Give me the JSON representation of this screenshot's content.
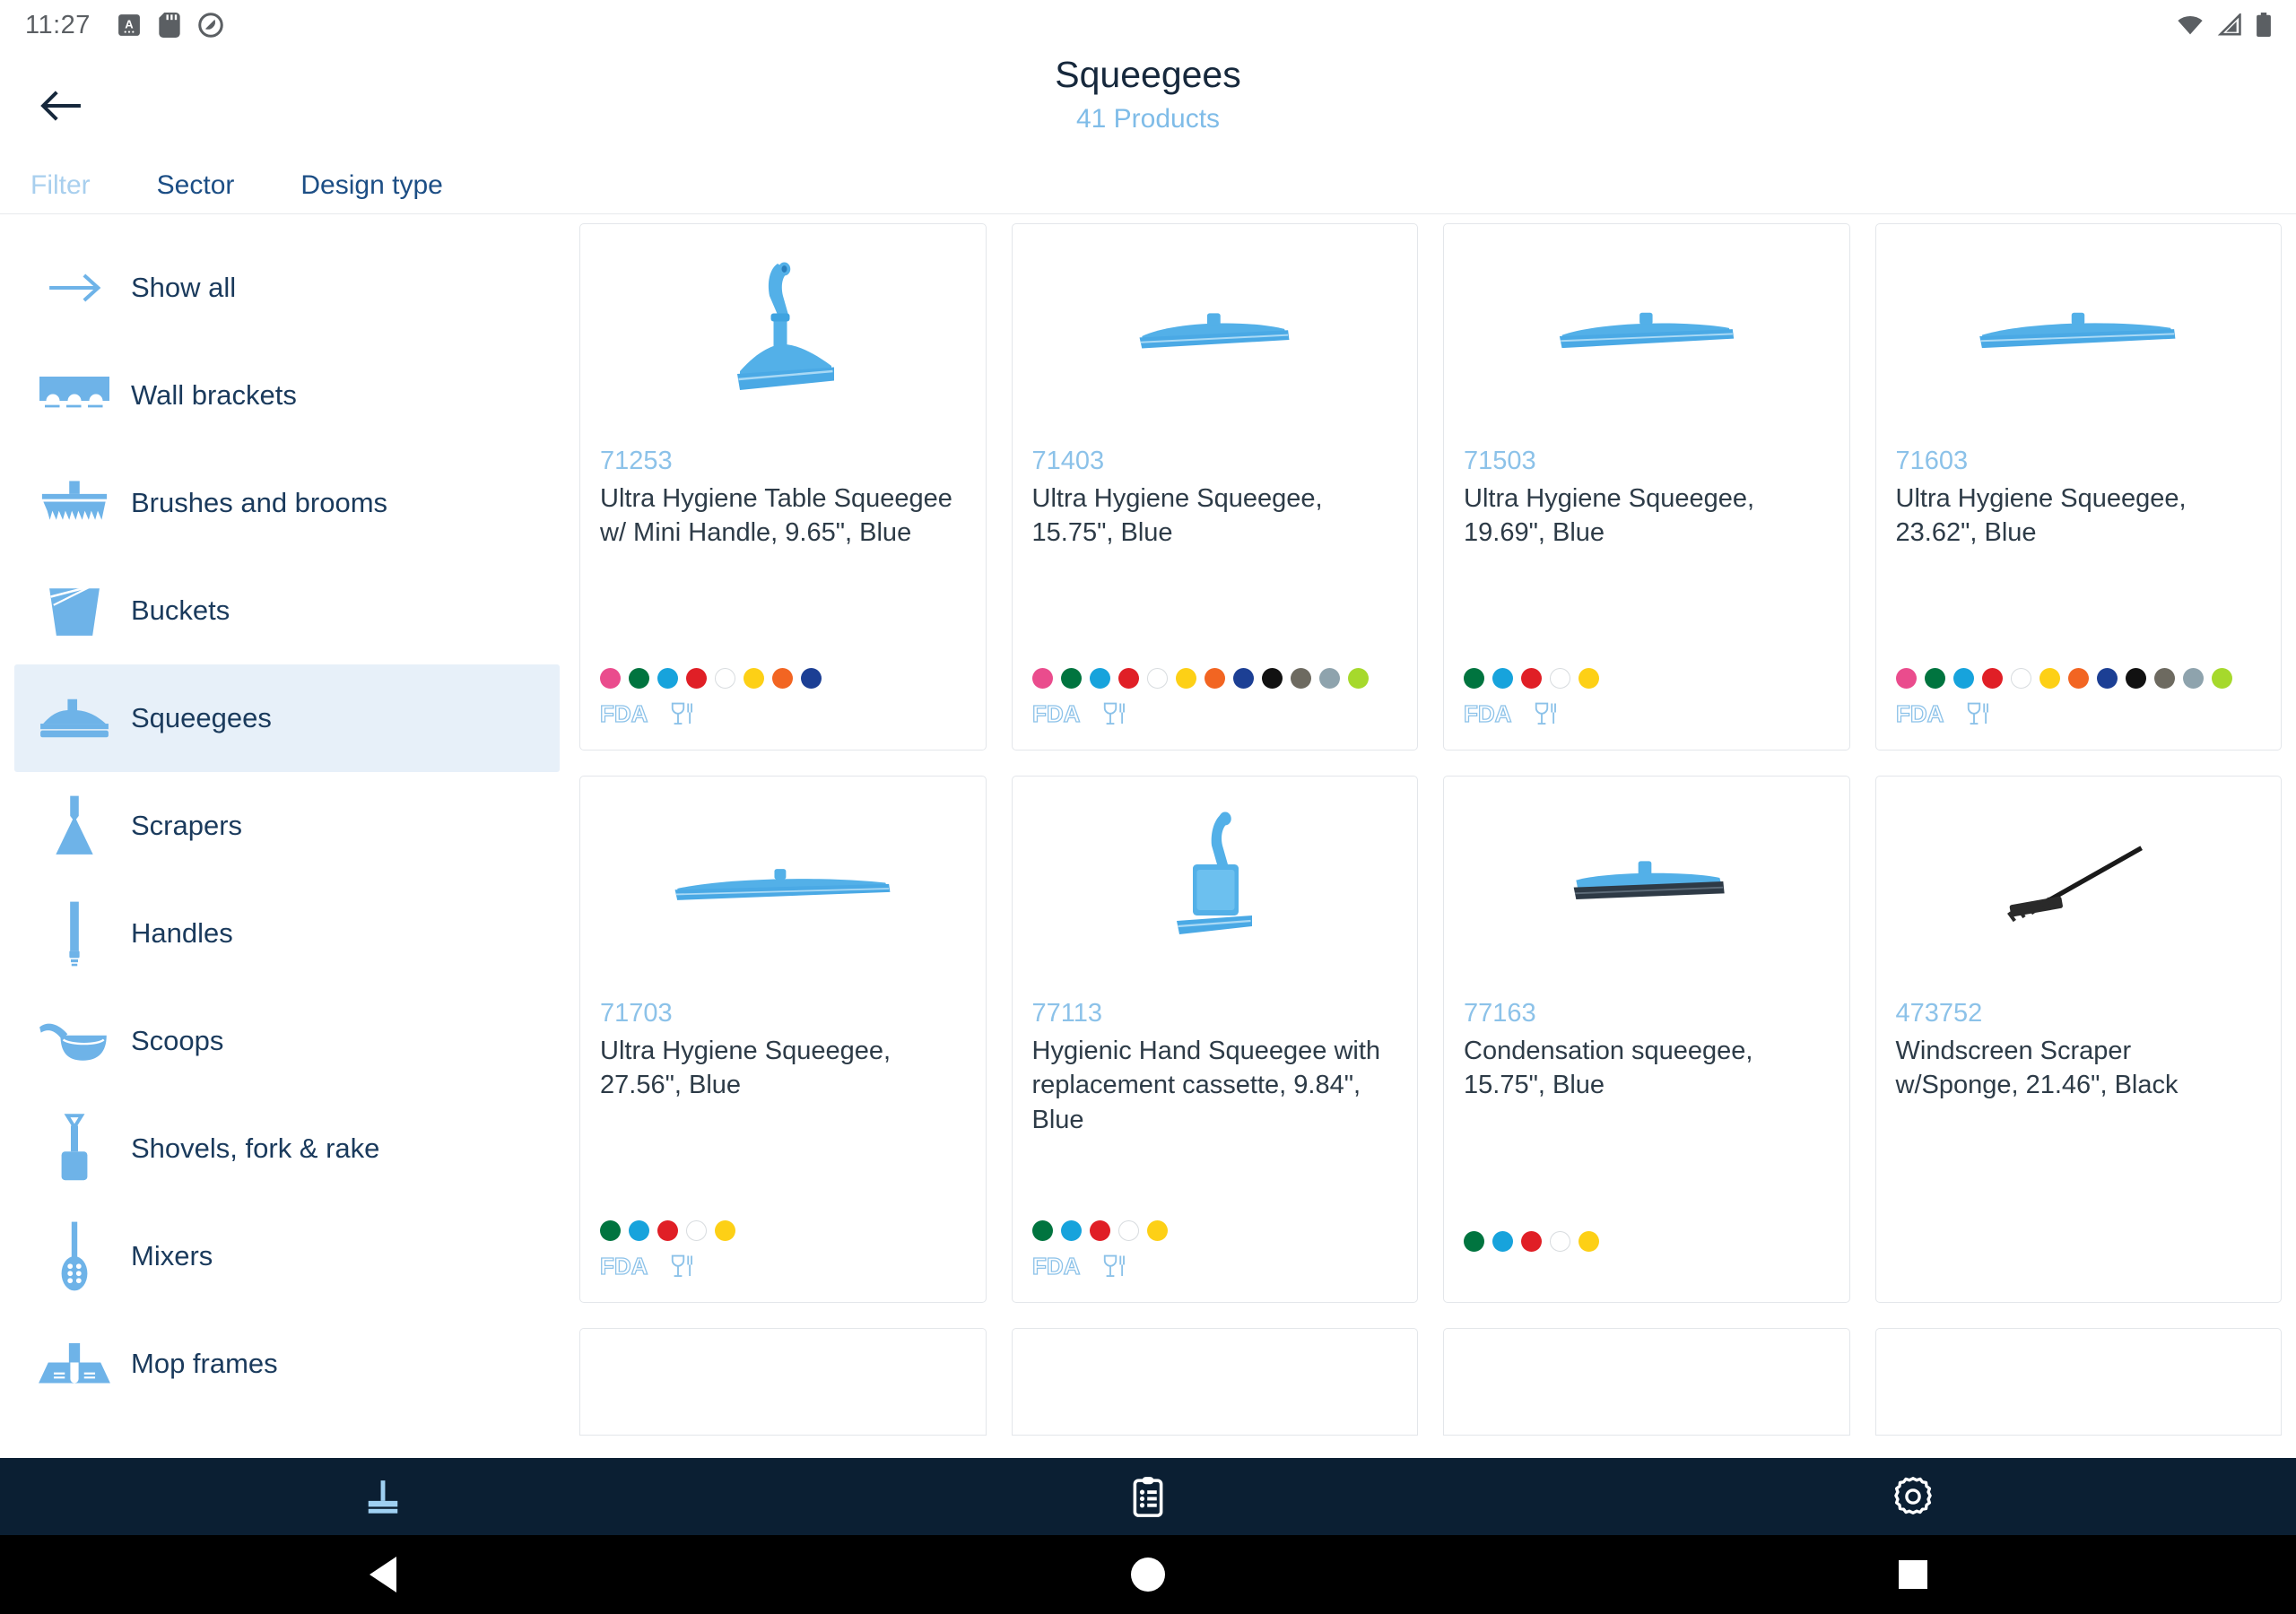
{
  "status_bar": {
    "time": "11:27",
    "left_icons": [
      "alphabet-badge-icon",
      "sd-card-icon",
      "do-not-disturb-icon"
    ],
    "right_icons": [
      "wifi-icon",
      "cellular-signal-icon",
      "battery-icon"
    ]
  },
  "app_bar": {
    "back_icon": "back-arrow-icon",
    "title": "Squeegees",
    "subtitle": "41 Products"
  },
  "filter_bar": {
    "tabs": [
      {
        "label": "Filter",
        "muted": true
      },
      {
        "label": "Sector",
        "muted": false
      },
      {
        "label": "Design type",
        "muted": false
      }
    ]
  },
  "sidebar": {
    "items": [
      {
        "label": "Show all",
        "icon": "arrow-right-icon",
        "active": false
      },
      {
        "label": "Wall brackets",
        "icon": "wall-bracket-icon",
        "active": false
      },
      {
        "label": "Brushes and brooms",
        "icon": "broom-icon",
        "active": false
      },
      {
        "label": "Buckets",
        "icon": "bucket-icon",
        "active": false
      },
      {
        "label": "Squeegees",
        "icon": "squeegee-icon",
        "active": true
      },
      {
        "label": "Scrapers",
        "icon": "scraper-icon",
        "active": false
      },
      {
        "label": "Handles",
        "icon": "handle-icon",
        "active": false
      },
      {
        "label": "Scoops",
        "icon": "scoop-icon",
        "active": false
      },
      {
        "label": "Shovels, fork & rake",
        "icon": "shovel-icon",
        "active": false
      },
      {
        "label": "Mixers",
        "icon": "mixer-icon",
        "active": false
      },
      {
        "label": "Mop frames",
        "icon": "mop-frame-icon",
        "active": false
      }
    ]
  },
  "colors": {
    "accent_blue": "#6eb3e8",
    "title_navy": "#16283c",
    "sku_blue": "#8cc2e9",
    "tab_blue": "#1c4e85",
    "tab_muted": "#a8cfee",
    "active_row_bg": "#e7f0f9",
    "bottom_nav_bg": "#0b1f33"
  },
  "products": [
    {
      "sku": "71253",
      "name": "Ultra Hygiene Table Squeegee w/ Mini Handle, 9.65\", Blue",
      "image": "table-squeegee-with-mini-handle-image",
      "swatches": [
        "#ea4c8d",
        "#00743f",
        "#17a3dc",
        "#e01f26",
        "#ffffff",
        "#fdd016",
        "#f26522",
        "#1c3f94"
      ],
      "badges": [
        "fda-logo",
        "food-safe-glass-fork-icon"
      ]
    },
    {
      "sku": "71403",
      "name": "Ultra Hygiene Squeegee, 15.75\", Blue",
      "image": "squeegee-head-15-image",
      "swatches": [
        "#ea4c8d",
        "#00743f",
        "#17a3dc",
        "#e01f26",
        "#ffffff",
        "#fdd016",
        "#f26522",
        "#1c3f94",
        "#111111",
        "#6d6a60",
        "#8ea3ad",
        "#a6d92c"
      ],
      "badges": [
        "fda-logo",
        "food-safe-glass-fork-icon"
      ]
    },
    {
      "sku": "71503",
      "name": "Ultra Hygiene Squeegee, 19.69\", Blue",
      "image": "squeegee-head-19-image",
      "swatches": [
        "#00743f",
        "#17a3dc",
        "#e01f26",
        "#ffffff",
        "#fdd016"
      ],
      "badges": [
        "fda-logo",
        "food-safe-glass-fork-icon"
      ]
    },
    {
      "sku": "71603",
      "name": "Ultra Hygiene Squeegee, 23.62\", Blue",
      "image": "squeegee-head-23-image",
      "swatches": [
        "#ea4c8d",
        "#00743f",
        "#17a3dc",
        "#e01f26",
        "#ffffff",
        "#fdd016",
        "#f26522",
        "#1c3f94",
        "#111111",
        "#6d6a60",
        "#8ea3ad",
        "#a6d92c"
      ],
      "badges": [
        "fda-logo",
        "food-safe-glass-fork-icon"
      ]
    },
    {
      "sku": "71703",
      "name": "Ultra Hygiene Squeegee, 27.56\", Blue",
      "image": "squeegee-head-27-image",
      "swatches": [
        "#00743f",
        "#17a3dc",
        "#e01f26",
        "#ffffff",
        "#fdd016"
      ],
      "badges": [
        "fda-logo",
        "food-safe-glass-fork-icon"
      ]
    },
    {
      "sku": "77113",
      "name": "Hygienic Hand Squeegee with replacement cassette, 9.84\", Blue",
      "image": "hand-squeegee-image",
      "swatches": [
        "#00743f",
        "#17a3dc",
        "#e01f26",
        "#ffffff",
        "#fdd016"
      ],
      "badges": [
        "fda-logo",
        "food-safe-glass-fork-icon"
      ]
    },
    {
      "sku": "77163",
      "name": "Condensation squeegee, 15.75\", Blue",
      "image": "condensation-squeegee-image",
      "swatches": [
        "#00743f",
        "#17a3dc",
        "#e01f26",
        "#ffffff",
        "#fdd016"
      ],
      "badges": []
    },
    {
      "sku": "473752",
      "name": "Windscreen Scraper w/Sponge, 21.46\", Black",
      "image": "windscreen-scraper-image",
      "swatches": [],
      "badges": []
    }
  ],
  "bottom_nav": {
    "items": [
      {
        "icon": "products-squeegee-icon",
        "active": true
      },
      {
        "icon": "clipboard-list-icon",
        "active": false
      },
      {
        "icon": "gear-settings-icon",
        "active": false
      }
    ]
  },
  "system_nav": {
    "items": [
      {
        "icon": "android-back-icon"
      },
      {
        "icon": "android-home-icon"
      },
      {
        "icon": "android-recents-icon"
      }
    ]
  }
}
